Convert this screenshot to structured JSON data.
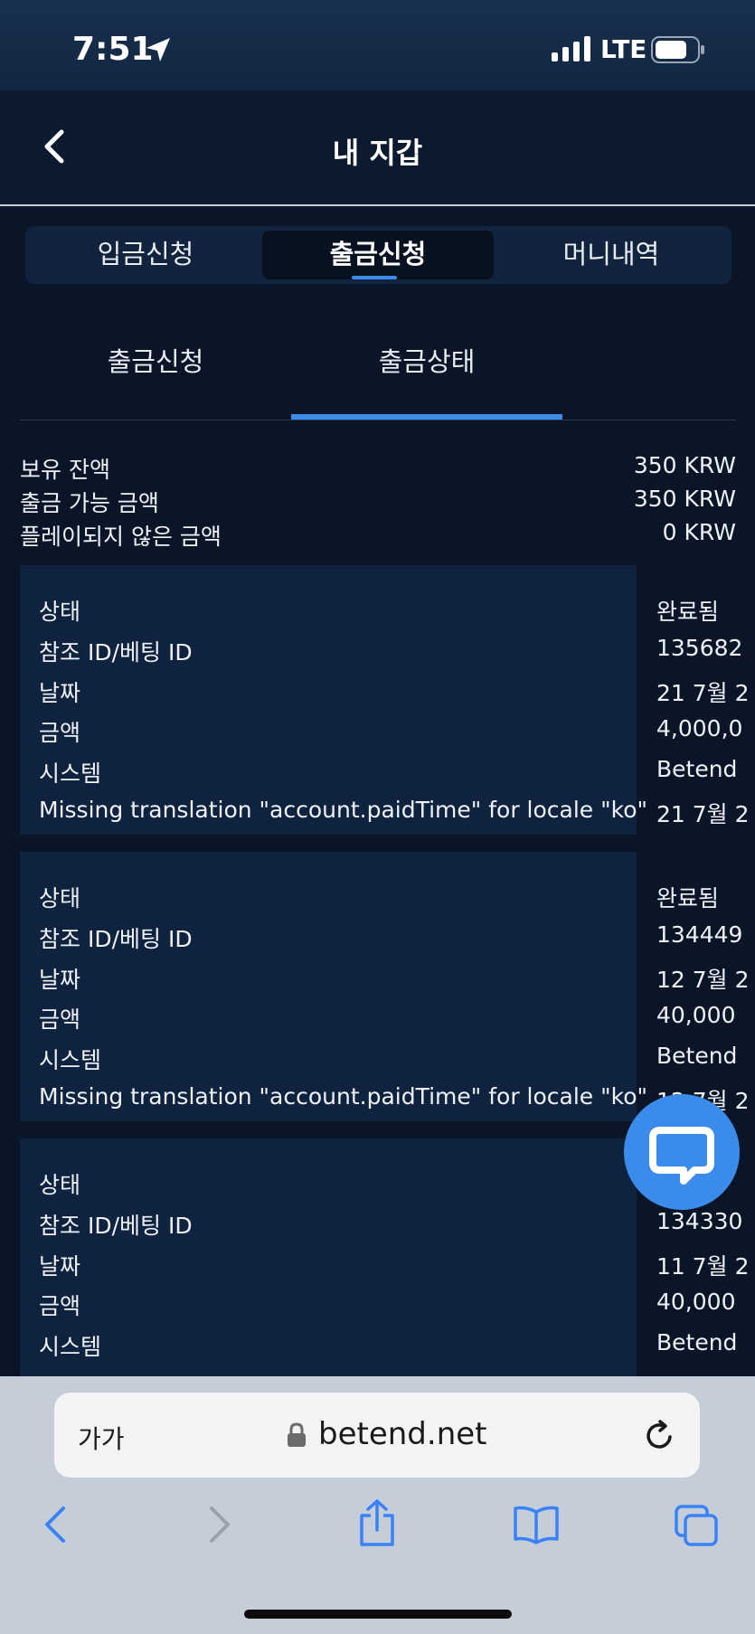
{
  "status_bar": {
    "time": "7:51",
    "network": "LTE"
  },
  "header": {
    "title": "내 지갑"
  },
  "tabs": [
    {
      "label": "입금신청",
      "active": false
    },
    {
      "label": "출금신청",
      "active": true
    },
    {
      "label": "머니내역",
      "active": false
    }
  ],
  "subtabs": [
    {
      "label": "출금신청",
      "active": false
    },
    {
      "label": "출금상태",
      "active": true
    }
  ],
  "balance": [
    {
      "label": "보유 잔액",
      "value": "350 KRW"
    },
    {
      "label": "출금 가능 금액",
      "value": "350 KRW"
    },
    {
      "label": "플레이되지 않은 금액",
      "value": "0 KRW"
    }
  ],
  "transactions": [
    {
      "status_label": "상태",
      "status_value": "완료됨",
      "ref_label": "참조 ID/베팅 ID",
      "ref_value": "135682",
      "date_label": "날짜",
      "date_value": "21 7월 2",
      "amount_label": "금액",
      "amount_value": "4,000,0",
      "system_label": "시스템",
      "system_value": "Betend",
      "paid_label": "Missing translation \"account.paidTime\" for locale \"ko\"",
      "paid_value": "21 7월 2"
    },
    {
      "status_label": "상태",
      "status_value": "완료됨",
      "ref_label": "참조 ID/베팅 ID",
      "ref_value": "134449",
      "date_label": "날짜",
      "date_value": "12 7월 2",
      "amount_label": "금액",
      "amount_value": "40,000",
      "system_label": "시스템",
      "system_value": "Betend",
      "paid_label": "Missing translation \"account.paidTime\" for locale \"ko\"",
      "paid_value": "12 7월 2"
    },
    {
      "status_label": "상태",
      "status_value": "",
      "ref_label": "참조 ID/베팅 ID",
      "ref_value": "134330",
      "date_label": "날짜",
      "date_value": "11 7월 2",
      "amount_label": "금액",
      "amount_value": "40,000",
      "system_label": "시스템",
      "system_value": "Betend",
      "paid_label": "",
      "paid_value": ""
    }
  ],
  "browser": {
    "text_size_label": "가가",
    "url": "betend.net"
  },
  "colors": {
    "accent": "#3b8beb",
    "background": "#0a1628",
    "card": "#10233e"
  }
}
